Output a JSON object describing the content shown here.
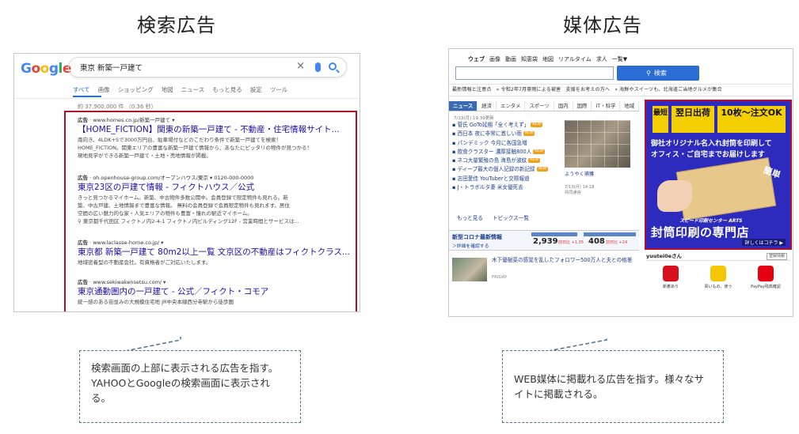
{
  "left": {
    "heading": "検索広告",
    "google": {
      "logo": "Google",
      "query": "東京 新築一戸建て",
      "tabs": [
        "すべて",
        "画像",
        "ショッピング",
        "地図",
        "ニュース",
        "もっと見る",
        "設定",
        "ツール"
      ],
      "result_count": "約 37,900,000 件 （0.36 秒）",
      "ads": [
        {
          "label": "広告",
          "url": "www.homes.co.jp/新築一戸建て",
          "title": "【HOME_FICTION】関東の新築一戸建て - 不動産・住宅情報サイト...",
          "desc": [
            "南向き、4LDK+Sで3000万円台、駐車場付などのこだわり条件で新築一戸建てを検索！",
            "HOME_FICTION。関東エリアの豊富な新築一戸建て情報から、あなたにピッタリの物件が見つかる！",
            "現地見学ができる新築一戸建て・土地・売地情報が掲載。"
          ]
        },
        {
          "label": "広告",
          "url": "oh.openhouse-group.com/オープンハウス/東京",
          "phone": "0120-000-0000",
          "title": "東京23区の戸建て情報 - フィクトハウス／公式",
          "desc": [
            "きっと見つかるマイホーム。新築、中古物件多数公開中。会員登録で限定物件も見れる。新",
            "築、中古戸建、土地情報まで豊富な情報。 無料の会員登録で会員限定物件も見れます。居住",
            "空間の広い魅力的な家・人気エリアの物件も豊富・憧れの駅近マイホーム。"
          ],
          "address": "東京都千代田区 フィクトノ内2-4-1 フィクトノ内ビルディング12F - 営業時間とサービスは..."
        },
        {
          "label": "広告",
          "url": "www.laclasse-home.co.jp/",
          "title": "東京都 新築一戸建て 80m2以上一覧 文京区の不動産はフィクトクラス...",
          "desc": [
            "地域密着型の不動産会社。有資格者がご対応いたします。"
          ]
        },
        {
          "label": "広告",
          "url": "www.sekiwakensetsu.com/",
          "title": "東京通勤圏内の一戸建て - 公式／フィクト・コモア",
          "desc": [
            "統一感のある街並みの大規模住宅地 JR中央本線西分寺駅から徒歩圏"
          ]
        }
      ]
    },
    "callout": "検索画面の上部に表示される広告を指す。YAHOOとGoogleの検索画面に表示される。"
  },
  "right": {
    "heading": "媒体広告",
    "yahoo": {
      "nav": [
        "ウェブ",
        "画像",
        "動画",
        "知恵袋",
        "地図",
        "リアルタイム",
        "求人",
        "一覧▼"
      ],
      "search_button": "検索",
      "strip": "最新情報と注意点　» 令和2年7月豪雨による被害　支援をお考えの方へ　» 海鮮やスイーツも、北海道ご当地グルメが集合",
      "tabs": [
        "ニュース",
        "経済",
        "エンタメ",
        "スポーツ",
        "国内",
        "国際",
        "IT・科学",
        "地域"
      ],
      "date": "7/13(月) 19:39更新",
      "news": [
        {
          "text": "菅氏 GoTo延期「全く考えず」",
          "new": "NEW"
        },
        {
          "text": "西日本 夜に非常に激しい雨",
          "new": "NEW"
        },
        {
          "text": "パンデミック 今月に各国急増",
          "new": ""
        },
        {
          "text": "飲食クラスター 濃厚接触800人",
          "new": "NEW"
        },
        {
          "text": "ネコ大量繁殖の島 海島が波紋",
          "new": "NEW"
        },
        {
          "text": "ディープ最大の個人記録の新記録",
          "new": "NEW"
        },
        {
          "text": "志田愛佳 YouTuberと交際報道",
          "new": ""
        },
        {
          "text": "J・トラボルタ妻 米女優死去",
          "new": ""
        }
      ],
      "photo_caption": "ようやく捕獲",
      "photo_date": "7/13(月) 14:18",
      "photo_source": "共同通信",
      "more_links": [
        "もっと見る",
        "トピックス一覧"
      ],
      "covid_title": "新型コロナ最新情報",
      "covid_sub": "＞詳細を確認する",
      "covid_nums": [
        {
          "value": "2,939",
          "delta": "前日比 +1,35"
        },
        {
          "value": "408",
          "delta": "前日比 +24"
        }
      ],
      "story_title": "木下優樹菜の感覚を乱したフォロワー500万人と夫との格差",
      "story_source": "FRIDAY",
      "banner": {
        "box1": "最短",
        "box2": "翌日出荷",
        "box3": "10枚〜注文OK",
        "line1": "御社オリジナル名入れ封筒を印刷して",
        "line2": "オフィス・ご自宅までお届けします",
        "kantan": "簡単",
        "logo": "スピード印刷センター ARTS",
        "big": "封筒印刷の専門店",
        "detail": "詳しくはコチラ ▶"
      },
      "user": "yuutei0eさん",
      "register": "登録情報",
      "services": [
        {
          "label": "新着あり",
          "color": "#d8101d"
        },
        {
          "label": "買いもの、使う",
          "color": "#f5c700"
        },
        {
          "label": "PayPay残高確認",
          "color": "#e60012"
        }
      ]
    },
    "callout": "WEB媒体に掲載れる広告を指す。様々なサイトに掲載される。"
  },
  "colors": {
    "highlight": "#b30f2a",
    "callout_border": "#4f6f8f",
    "link": "#1a0dab",
    "banner": "#2c2bbd"
  }
}
